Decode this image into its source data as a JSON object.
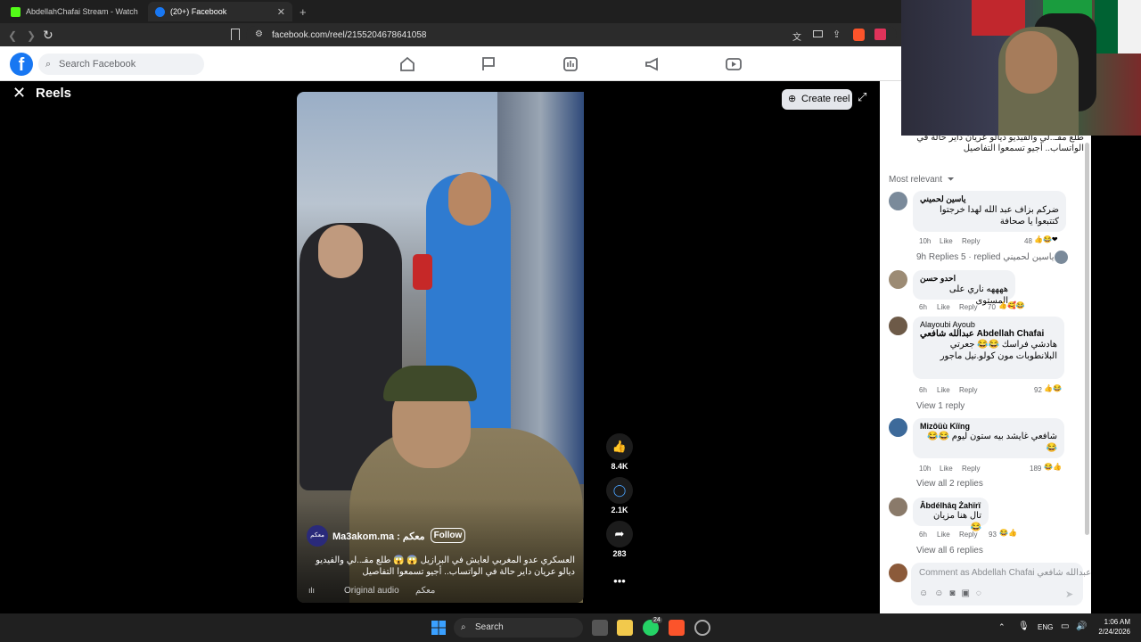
{
  "browser": {
    "tabs": [
      {
        "title": "AbdellahChafai Stream - Watch Live"
      },
      {
        "title": "(20+) Facebook"
      }
    ],
    "url": "facebook.com/reel/2155204678641058",
    "new_tab_label": "+"
  },
  "facebook": {
    "logo": "f",
    "search_placeholder": "Search Facebook",
    "nav_icons": [
      "home-icon",
      "flag-icon",
      "marketplace-icon",
      "megaphone-icon",
      "video-icon"
    ]
  },
  "reels": {
    "title": "Reels",
    "create_reel": "Create reel",
    "page_name": "Ma3akom.ma : معكم",
    "page_avatar_text": "معكم",
    "follow": "Follow",
    "caption": "العسكري عدو المغربي لعايش في البرازيل 😱 😱 طلع مقـ..لي والفيديو ديالو عريان داير حالة في الواتساب.. أجيو تسمعوا التفاصيل",
    "audio": "Original audio",
    "audio_page": "معكم",
    "likes": "8.4K",
    "comments": "2.1K",
    "shares": "283"
  },
  "comments_panel": {
    "description": "طلع مقـ..لي والفيديو ديالو عريان داير حالة في الواتساب.. أجيو تسمعوا التفاصيل",
    "sort": "Most relevant",
    "comments": [
      {
        "name": "ياسين لحميني",
        "text": "ضركم بزاف عبد الله لهدا خرجتوا كتتبعوا يا صحافة",
        "time": "10h",
        "like": "Like",
        "reply": "Reply",
        "reactions": "48",
        "replies_summary": "9h  Replies 5 · replied ياسين لحميني"
      },
      {
        "name": "احدو حسن",
        "text": "ههههه ناري على المستوى",
        "time": "6h",
        "like": "Like",
        "reply": "Reply",
        "reactions": "70"
      },
      {
        "name": "Alayoubi Ayoub",
        "mention": "عبدالله شافعي Abdellah Chafai",
        "text": "هادشي فراسك 😂😂 جعرتي البلانطوبات مون كولو.نيل ماجور",
        "time": "6h",
        "like": "Like",
        "reply": "Reply",
        "reactions": "92",
        "view_replies": "View 1 reply"
      },
      {
        "name": "Mizôüù Kïïng",
        "text": "شافعي غايشد بيه ستون ليوم 😂😂😂",
        "time": "10h",
        "like": "Like",
        "reply": "Reply",
        "reactions": "189",
        "view_replies": "View all 2 replies"
      },
      {
        "name": "Âbdélhâq Żahïrï",
        "text": "تال هنا مزيان 😂",
        "time": "6h",
        "like": "Like",
        "reply": "Reply",
        "reactions": "93",
        "view_replies": "View all 6 replies"
      }
    ],
    "comment_placeholder": "Comment as Abdellah Chafai عبدالله شافعي"
  },
  "taskbar": {
    "search": "Search",
    "lang": "ENG",
    "time": "1:06 AM",
    "date": "2/24/2026",
    "badge": "24"
  },
  "colors": {
    "fb_blue": "#1877f2",
    "panel_bg": "#ffffff",
    "bubble_bg": "#f0f2f5"
  }
}
